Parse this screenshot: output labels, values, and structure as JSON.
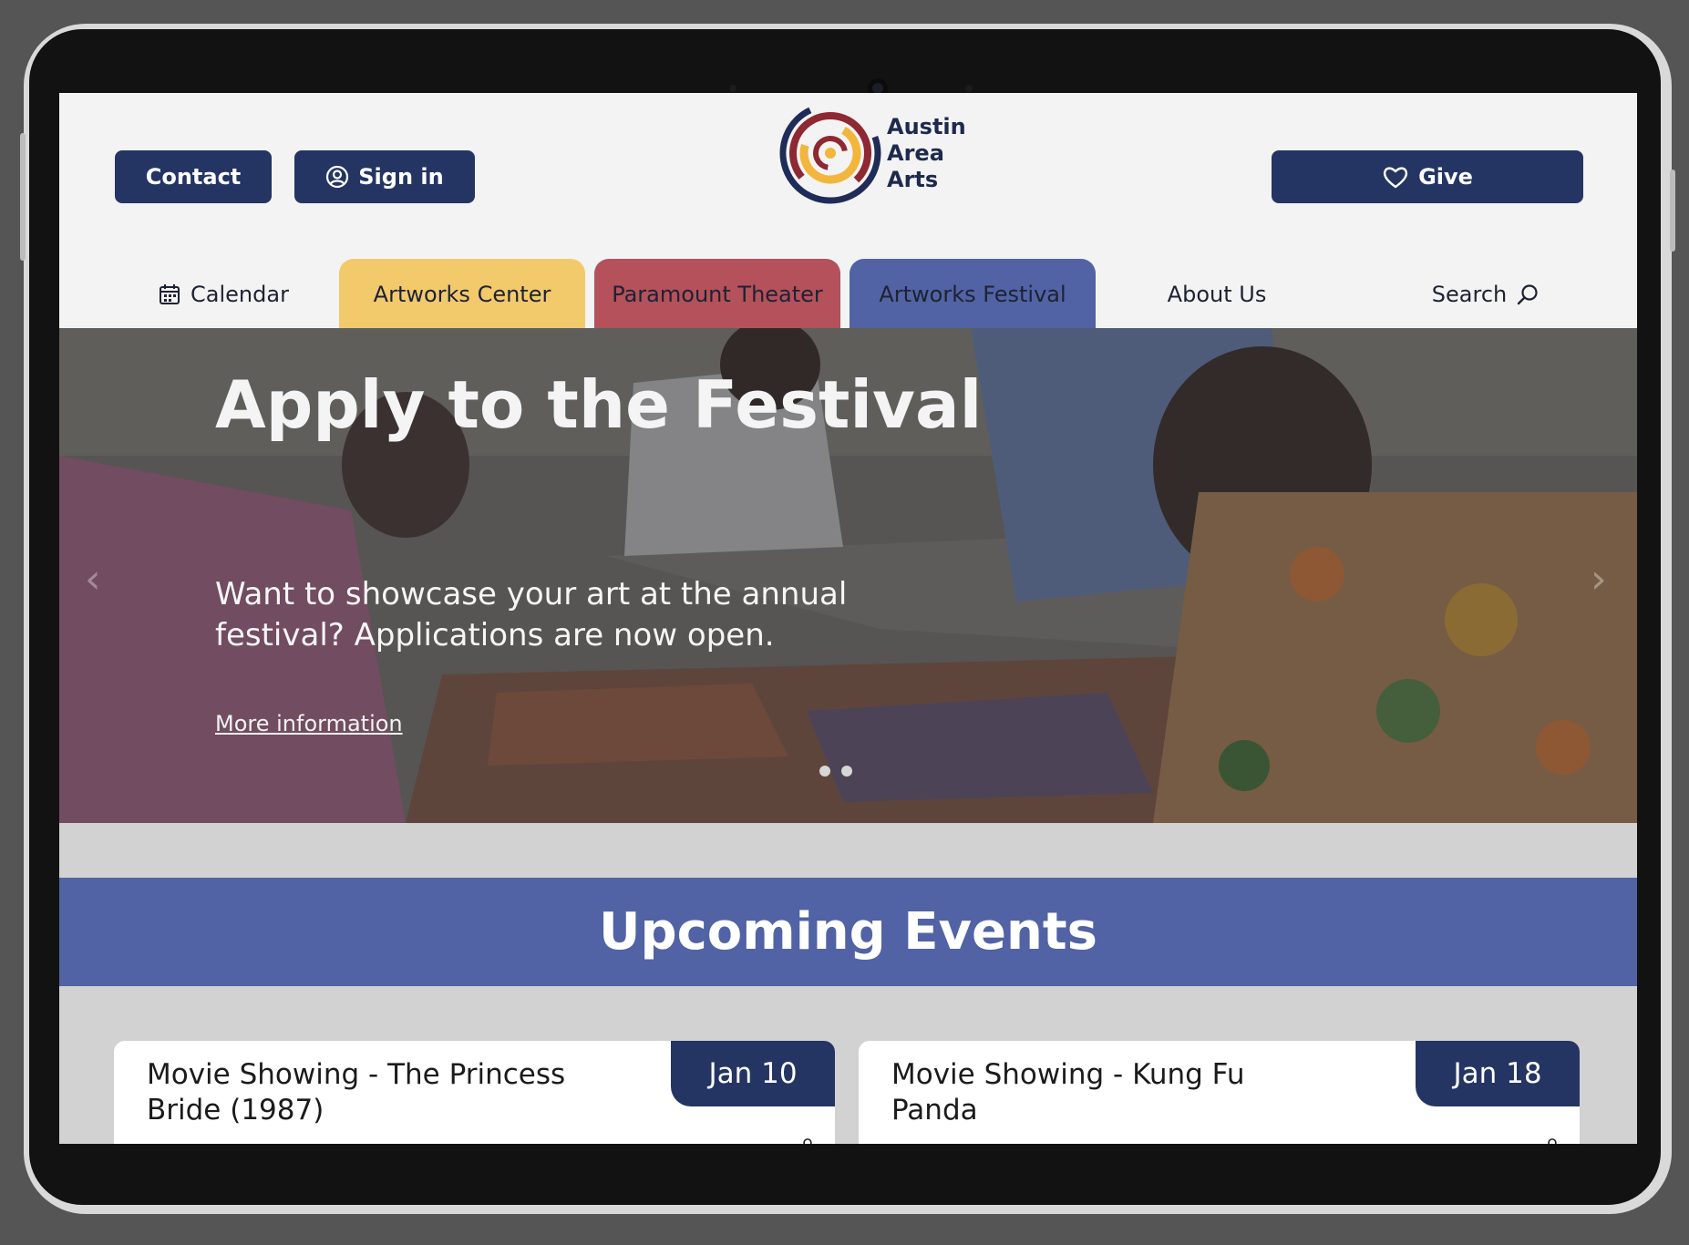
{
  "header": {
    "contact_label": "Contact",
    "signin_label": "Sign in",
    "give_label": "Give",
    "logo": {
      "line1": "Austin",
      "line2": "Area",
      "line3": "Arts"
    }
  },
  "nav": {
    "items": [
      {
        "label": "Calendar",
        "icon": "calendar-icon"
      },
      {
        "label": "Artworks Center",
        "color": "#f2c96b"
      },
      {
        "label": "Paramount Theater",
        "color": "#b4515a"
      },
      {
        "label": "Artworks Festival",
        "color": "#5163a4"
      },
      {
        "label": "About Us"
      },
      {
        "label": "Search",
        "icon": "search-icon"
      }
    ]
  },
  "hero": {
    "title": "Apply to the Festival",
    "text": "Want to showcase your art at the annual festival? Applications are now open.",
    "link_label": "More information",
    "slides": 2,
    "active_slide": 1
  },
  "events": {
    "heading": "Upcoming Events",
    "cards": [
      {
        "title": "Movie Showing - The Princess Bride (1987)",
        "date": "Jan 10"
      },
      {
        "title": "Movie Showing - Kung Fu Panda",
        "date": "Jan 18"
      }
    ]
  },
  "colors": {
    "navy": "#243564",
    "festival_blue": "#5163a4",
    "center_yellow": "#f2c96b",
    "theater_red": "#b4515a"
  }
}
